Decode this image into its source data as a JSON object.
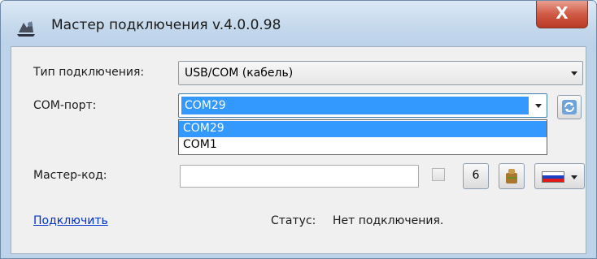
{
  "window": {
    "title": "Мастер подключения v.4.0.0.98",
    "close_glyph": "X"
  },
  "connection_type": {
    "label": "Тип подключения:",
    "value": "USB/COM (кабель)"
  },
  "com_port": {
    "label": "COM-порт:",
    "value": "COM29",
    "options": [
      "COM29",
      "COM1"
    ],
    "selected_option": "COM29"
  },
  "master_code": {
    "label": "Мастер-код:",
    "value": "",
    "checked": false,
    "button_6_label": "6"
  },
  "language": {
    "flag_colors": [
      "#ffffff",
      "#1c3fc4",
      "#e01a1a"
    ]
  },
  "footer": {
    "connect_link": "Подключить",
    "status_label": "Статус:",
    "status_value": "Нет подключения."
  },
  "icons": {
    "app": "app-icon",
    "refresh": "refresh-icon",
    "bag": "bag-icon",
    "flag": "russian-flag-icon"
  }
}
